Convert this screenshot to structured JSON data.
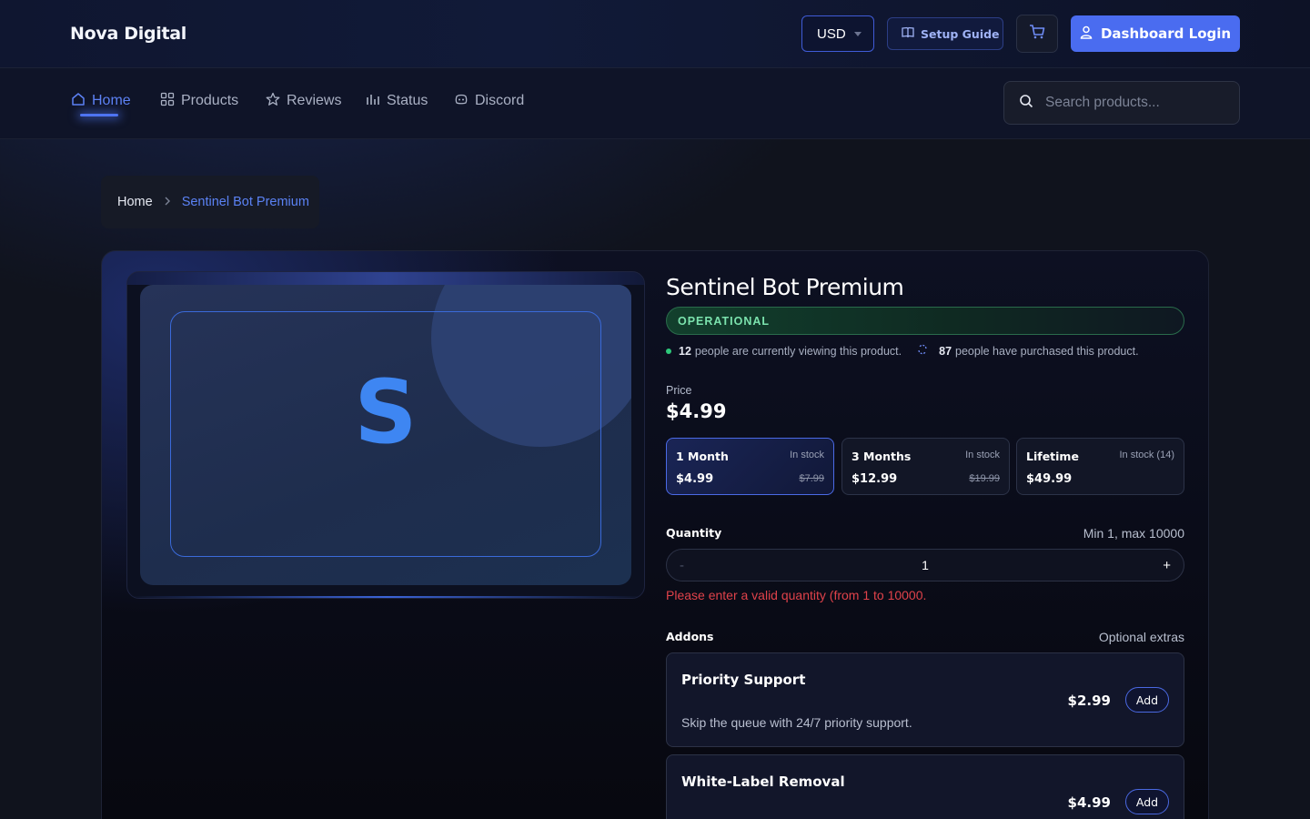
{
  "header": {
    "brand": "Nova Digital",
    "currency": "USD",
    "setup_guide": "Setup Guide",
    "login": "Dashboard Login"
  },
  "nav": {
    "items": [
      {
        "label": "Home",
        "icon": "home-icon",
        "active": true
      },
      {
        "label": "Products",
        "icon": "grid-icon"
      },
      {
        "label": "Reviews",
        "icon": "star-icon"
      },
      {
        "label": "Status",
        "icon": "bar-chart-icon"
      },
      {
        "label": "Discord",
        "icon": "discord-icon"
      }
    ],
    "search_placeholder": "Search products..."
  },
  "breadcrumb": {
    "home": "Home",
    "current": "Sentinel Bot Premium"
  },
  "product": {
    "image_letter": "S",
    "title": "Sentinel Bot Premium",
    "status": "OPERATIONAL",
    "viewers_count": "12",
    "viewers_text": "people are currently viewing this product.",
    "purchased_count": "87",
    "purchased_text": "people have purchased this product.",
    "price_label": "Price",
    "price": "$4.99",
    "plans": [
      {
        "name": "1 Month",
        "stock": "In stock",
        "price": "$4.99",
        "old_price": "$7.99",
        "selected": true
      },
      {
        "name": "3 Months",
        "stock": "In stock",
        "price": "$12.99",
        "old_price": "$19.99"
      },
      {
        "name": "Lifetime",
        "stock": "In stock (14)",
        "price": "$49.99",
        "old_price": ""
      }
    ],
    "quantity_label": "Quantity",
    "quantity_range": "Min 1, max 10000",
    "quantity_minus": "-",
    "quantity_value": "1",
    "quantity_plus": "+",
    "quantity_error": "Please enter a valid quantity (from 1 to 10000.",
    "addons_label": "Addons",
    "addons_hint": "Optional extras",
    "addons": [
      {
        "name": "Priority Support",
        "description": "Skip the queue with 24/7 priority support.",
        "price": "$2.99",
        "button": "Add"
      },
      {
        "name": "White-Label Removal",
        "description": "",
        "price": "$4.99",
        "button": "Add"
      }
    ]
  },
  "colors": {
    "accent": "#4a6cf0",
    "status_green": "#7be2ad",
    "error": "#e0424a",
    "background": "#10131d"
  }
}
